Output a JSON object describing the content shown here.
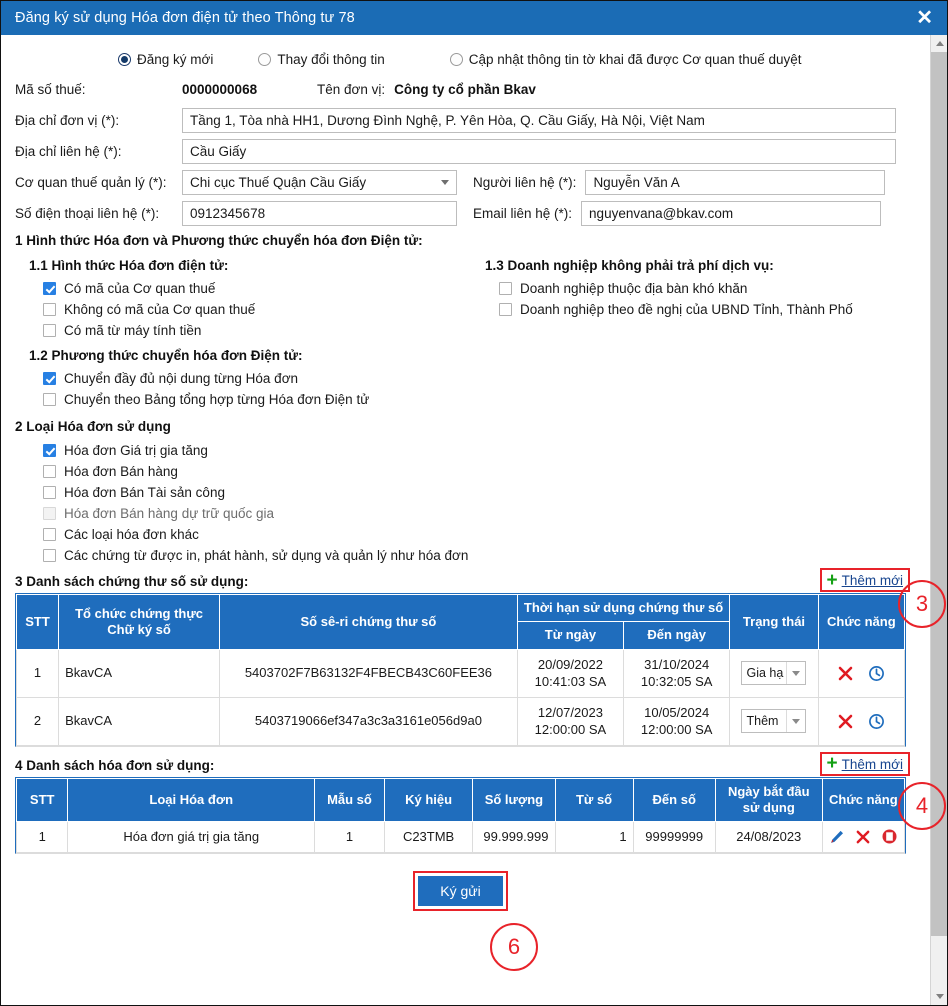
{
  "window": {
    "title": "Đăng ký sử dụng Hóa đơn điện tử theo Thông tư 78",
    "close_label": "✕",
    "header_color": "#1b6cb5",
    "table_header_color": "#1f6dbd",
    "accent_red": "#e8232a"
  },
  "mode_options": [
    {
      "label": "Đăng ký mới",
      "selected": true
    },
    {
      "label": "Thay đổi thông tin",
      "selected": false
    },
    {
      "label": "Cập nhật thông tin tờ khai đã được Cơ quan thuế duyệt",
      "selected": false
    }
  ],
  "fields": {
    "tax_code_label": "Mã số thuế:",
    "tax_code_value": "0000000068",
    "company_label": "Tên đơn vị:",
    "company_value": "Công ty cổ phần Bkav",
    "address_label": "Địa chỉ đơn vị (*):",
    "address_value": "Tầng 1, Tòa nhà HH1, Dương Đình Nghệ, P. Yên Hòa, Q. Cầu Giấy, Hà Nội, Việt Nam",
    "contact_address_label": "Địa chỉ liên hệ (*):",
    "contact_address_value": "Cầu Giấy",
    "tax_office_label": "Cơ quan thuế quản lý (*):",
    "tax_office_value": "Chi cục Thuế Quận Cầu Giấy",
    "contact_person_label": "Người liên hệ (*):",
    "contact_person_value": "Nguyễn Văn A",
    "phone_label": "Số điện thoại liên hệ (*):",
    "phone_value": "0912345678",
    "email_label": "Email liên hệ (*):",
    "email_value": "nguyenvana@bkav.com"
  },
  "section1": {
    "title": "1 Hình thức Hóa đơn và Phương thức chuyển hóa đơn Điện tử:",
    "sub11_title": "1.1 Hình thức Hóa đơn điện tử:",
    "sub11_items": [
      {
        "label": "Có mã của Cơ quan thuế",
        "checked": true,
        "disabled": false
      },
      {
        "label": "Không có mã của Cơ quan thuế",
        "checked": false,
        "disabled": false
      },
      {
        "label": "Có mã từ máy tính tiền",
        "checked": false,
        "disabled": false
      }
    ],
    "sub12_title": "1.2 Phương thức chuyển hóa đơn Điện tử:",
    "sub12_items": [
      {
        "label": "Chuyển đầy đủ nội dung từng Hóa đơn",
        "checked": true,
        "disabled": false
      },
      {
        "label": "Chuyển theo Bảng tổng hợp từng Hóa đơn Điện tử",
        "checked": false,
        "disabled": false
      }
    ],
    "sub13_title": "1.3 Doanh nghiệp không phải trả phí dịch vụ:",
    "sub13_items": [
      {
        "label": "Doanh nghiệp thuộc địa bàn khó khăn",
        "checked": false,
        "disabled": false
      },
      {
        "label": "Doanh nghiệp theo đề nghị của UBND Tỉnh, Thành Phố",
        "checked": false,
        "disabled": false
      }
    ]
  },
  "section2": {
    "title": "2 Loại Hóa đơn sử dụng",
    "items": [
      {
        "label": "Hóa đơn Giá trị gia tăng",
        "checked": true,
        "disabled": false
      },
      {
        "label": "Hóa đơn Bán hàng",
        "checked": false,
        "disabled": false
      },
      {
        "label": "Hóa đơn Bán Tài sản công",
        "checked": false,
        "disabled": false
      },
      {
        "label": "Hóa đơn Bán hàng dự trữ quốc gia",
        "checked": false,
        "disabled": true
      },
      {
        "label": "Các loại hóa đơn khác",
        "checked": false,
        "disabled": false
      },
      {
        "label": "Các chứng từ được in, phát hành, sử dụng và quản lý như hóa đơn",
        "checked": false,
        "disabled": false
      }
    ]
  },
  "section3": {
    "title": "3 Danh sách chứng thư số sử dụng:",
    "add_label": "Thêm mới",
    "headers": {
      "stt": "STT",
      "org": "Tổ chức chứng thực Chữ ký số",
      "serial": "Số sê-ri chứng thư số",
      "period": "Thời hạn sử dụng chứng thư số",
      "from": "Từ ngày",
      "to": "Đến ngày",
      "status": "Trạng thái",
      "action": "Chức năng"
    },
    "rows": [
      {
        "stt": "1",
        "org": "BkavCA",
        "serial": "5403702F7B63132F4FBECB43C60FEE36",
        "from_date": "20/09/2022",
        "from_time": "10:41:03 SA",
        "to_date": "31/10/2024",
        "to_time": "10:32:05 SA",
        "status": "Gia hạ"
      },
      {
        "stt": "2",
        "org": "BkavCA",
        "serial": "5403719066ef347a3c3a3161e056d9a0",
        "from_date": "12/07/2023",
        "from_time": "12:00:00 SA",
        "to_date": "10/05/2024",
        "to_time": "12:00:00 SA",
        "status": "Thêm"
      }
    ]
  },
  "section4": {
    "title": "4 Danh sách hóa đơn sử dụng:",
    "add_label": "Thêm mới",
    "headers": {
      "stt": "STT",
      "type": "Loại Hóa đơn",
      "form": "Mẫu số",
      "symbol": "Ký hiệu",
      "qty": "Số lượng",
      "from_no": "Từ số",
      "to_no": "Đến số",
      "start_date": "Ngày bắt đầu sử dụng",
      "action": "Chức năng"
    },
    "rows": [
      {
        "stt": "1",
        "type": "Hóa đơn giá trị gia tăng",
        "form": "1",
        "symbol": "C23TMB",
        "qty": "99.999.999",
        "from_no": "1",
        "to_no": "99999999",
        "start_date": "24/08/2023"
      }
    ]
  },
  "footer": {
    "submit_label": "Ký gửi"
  },
  "annotations": [
    {
      "number": "3"
    },
    {
      "number": "4"
    },
    {
      "number": "6"
    }
  ]
}
